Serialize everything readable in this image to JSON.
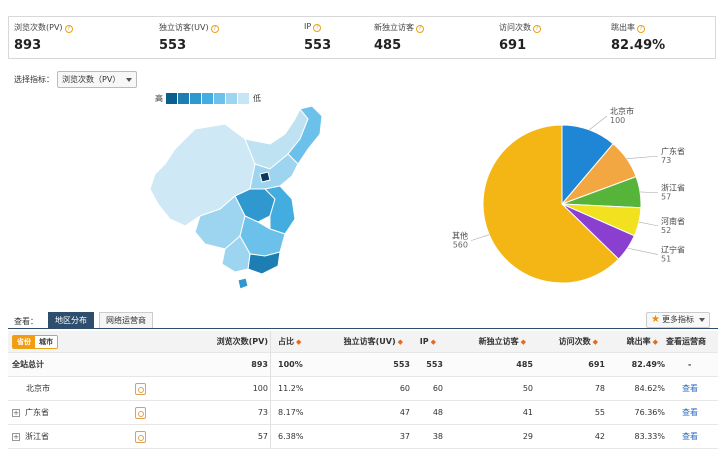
{
  "metrics": [
    {
      "label": "浏览次数(PV)",
      "value": "893"
    },
    {
      "label": "独立访客(UV)",
      "value": "553"
    },
    {
      "label": "IP",
      "value": "553"
    },
    {
      "label": "新独立访客",
      "value": "485"
    },
    {
      "label": "访问次数",
      "value": "691"
    },
    {
      "label": "跳出率",
      "value": "82.49%"
    }
  ],
  "selector": {
    "label": "选择指标：",
    "value": "浏览次数（PV）"
  },
  "legend": {
    "high": "高",
    "low": "低",
    "colors": [
      "#0b5f8f",
      "#1c7eb3",
      "#2e98cf",
      "#44ade0",
      "#6cc1ea",
      "#9dd5f1",
      "#c6e6f6"
    ]
  },
  "pie": [
    {
      "name": "北京市",
      "value": "100",
      "color": "#1f86d6"
    },
    {
      "name": "广东省",
      "value": "73",
      "color": "#f3a742"
    },
    {
      "name": "浙江省",
      "value": "57",
      "color": "#56b43b"
    },
    {
      "name": "河南省",
      "value": "52",
      "color": "#f1e11e"
    },
    {
      "name": "辽宁省",
      "value": "51",
      "color": "#8b3fd1"
    },
    {
      "name": "其他",
      "value": "560",
      "color": "#f3b614"
    }
  ],
  "view": {
    "label": "查看：",
    "tab_active": "地区分布",
    "tab_inactive": "网络运营商",
    "more": "更多指标"
  },
  "table": {
    "toggle_on": "省份",
    "toggle_off": "城市",
    "headers": [
      "浏览次数(PV)",
      "占比",
      "独立访客(UV)",
      "IP",
      "新独立访客",
      "访问次数",
      "跳出率",
      "查看运营商"
    ],
    "rows": [
      {
        "name": "全站总计",
        "pv": "893",
        "ratio": "100%",
        "uv": "553",
        "ip": "553",
        "new": "485",
        "visits": "691",
        "bounce": "82.49%",
        "op": "-"
      },
      {
        "name": "北京市",
        "pv": "100",
        "ratio": "11.2%",
        "uv": "60",
        "ip": "60",
        "new": "50",
        "visits": "78",
        "bounce": "84.62%",
        "op": "查看"
      },
      {
        "name": "广东省",
        "pv": "73",
        "ratio": "8.17%",
        "uv": "47",
        "ip": "48",
        "new": "41",
        "visits": "55",
        "bounce": "76.36%",
        "op": "查看"
      },
      {
        "name": "浙江省",
        "pv": "57",
        "ratio": "6.38%",
        "uv": "37",
        "ip": "38",
        "new": "29",
        "visits": "42",
        "bounce": "83.33%",
        "op": "查看"
      }
    ]
  }
}
